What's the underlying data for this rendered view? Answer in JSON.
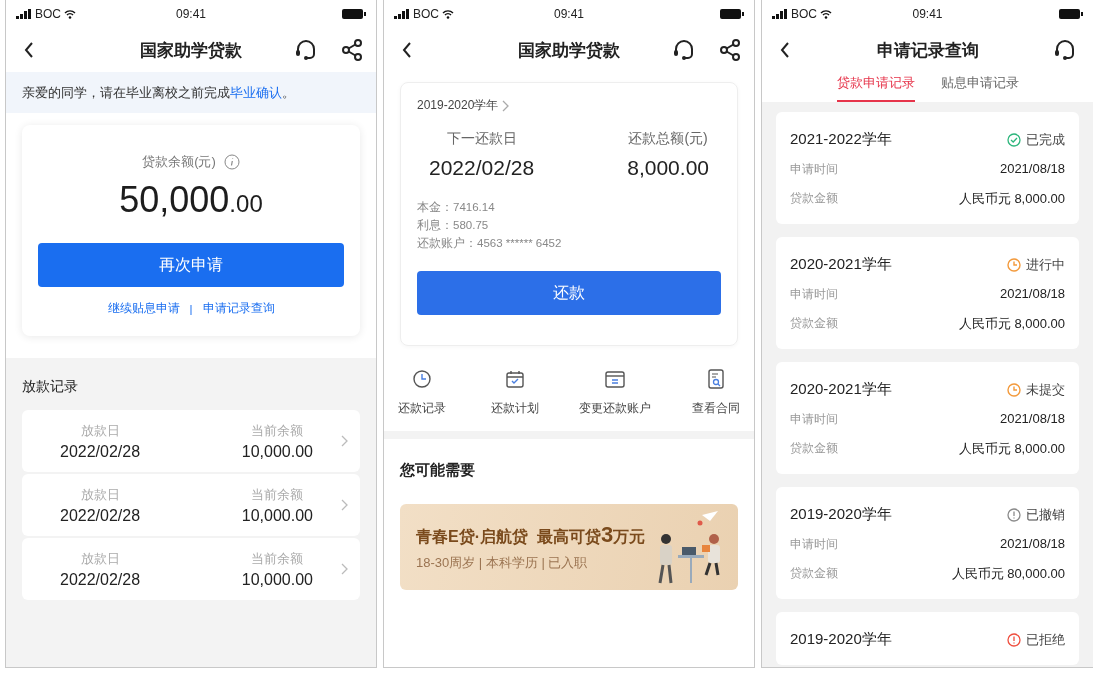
{
  "loan_overview": {
    "status_bar": {
      "carrier": "BOC",
      "time": "09:41"
    },
    "title": "国家助学贷款",
    "notice": {
      "before": "亲爱的同学，请在毕业离校之前完成",
      "link": "毕业确认",
      "after": "。"
    },
    "balance": {
      "label": "贷款余额(元)",
      "integer": "50,000",
      "decimal": ".00"
    },
    "apply_button": "再次申请",
    "links": [
      {
        "label": "继续贴息申请"
      },
      {
        "label": "申请记录查询"
      }
    ],
    "separator": "|",
    "disbursements": {
      "title": "放款记录",
      "rows": [
        {
          "date_label": "放款日",
          "date": "2022/02/28",
          "balance_label": "当前余额",
          "balance": "10,000.00"
        },
        {
          "date_label": "放款日",
          "date": "2022/02/28",
          "balance_label": "当前余额",
          "balance": "10,000.00"
        },
        {
          "date_label": "放款日",
          "date": "2022/02/28",
          "balance_label": "当前余额",
          "balance": "10,000.00"
        }
      ]
    }
  },
  "repayment": {
    "status_bar": {
      "carrier": "BOC",
      "time": "09:41"
    },
    "title": "国家助学贷款",
    "card": {
      "year": "2019-2020学年",
      "next_date_label": "下一还款日",
      "next_date": "2022/02/28",
      "total_label": "还款总额(元)",
      "total": "8,000.00",
      "details": [
        "本金：7416.14",
        "利息：580.75",
        "还款账户：4563 ****** 6452"
      ],
      "button": "还款"
    },
    "actions": [
      {
        "label": "还款记录",
        "kind": "clock"
      },
      {
        "label": "还款计划",
        "kind": "calendar"
      },
      {
        "label": "变更还款账户",
        "kind": "card"
      },
      {
        "label": "查看合同",
        "kind": "document"
      }
    ],
    "suggest_title": "您可能需要",
    "banner": {
      "title": "青春E贷·启航贷",
      "offer_before": "最高可贷",
      "offer_number": "3",
      "offer_after": "万元",
      "subtitle": "18-30周岁 | 本科学历 | 已入职"
    }
  },
  "application_records": {
    "status_bar": {
      "carrier": "BOC",
      "time": "09:41"
    },
    "title": "申请记录查询",
    "tabs": [
      {
        "label": "贷款申请记录",
        "selected": true
      },
      {
        "label": "贴息申请记录",
        "selected": false
      }
    ],
    "records": [
      {
        "year": "2021-2022学年",
        "status": {
          "label": "已完成",
          "kind": "check",
          "color": "#2db67c"
        },
        "fields": [
          {
            "label": "申请时间",
            "value": "2021/08/18"
          },
          {
            "label": "贷款金额",
            "value": "人民币元 8,000.00"
          }
        ]
      },
      {
        "year": "2020-2021学年",
        "status": {
          "label": "进行中",
          "kind": "clock",
          "color": "#f39a3c"
        },
        "fields": [
          {
            "label": "申请时间",
            "value": "2021/08/18"
          },
          {
            "label": "贷款金额",
            "value": "人民币元 8,000.00"
          }
        ]
      },
      {
        "year": "2020-2021学年",
        "status": {
          "label": "未提交",
          "kind": "clock",
          "color": "#f39a3c"
        },
        "fields": [
          {
            "label": "申请时间",
            "value": "2021/08/18"
          },
          {
            "label": "贷款金额",
            "value": "人民币元 8,000.00"
          }
        ]
      },
      {
        "year": "2019-2020学年",
        "status": {
          "label": "已撤销",
          "kind": "info",
          "color": "#8a8a8a"
        },
        "fields": [
          {
            "label": "申请时间",
            "value": "2021/08/18"
          },
          {
            "label": "贷款金额",
            "value": "人民币元 80,000.00"
          }
        ]
      },
      {
        "year": "2019-2020学年",
        "status": {
          "label": "已拒绝",
          "kind": "info",
          "color": "#ef4e3e"
        }
      }
    ]
  }
}
